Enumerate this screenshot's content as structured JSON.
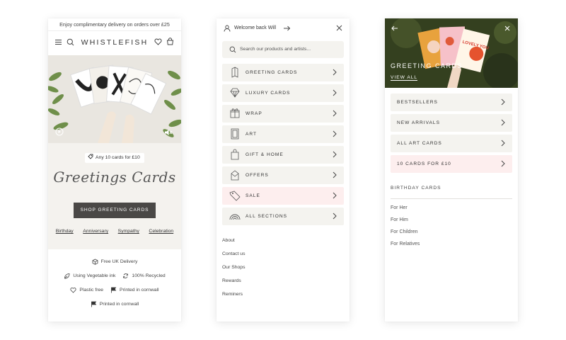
{
  "screen1": {
    "promo": "Enjoy complimentary delivery on orders over £25",
    "brand": "WHISTLEFISH",
    "offer_pill": "Any 10 cards for £10",
    "hero_title": "Greetings Cards",
    "shop_button": "SHOP GREETING CARDS",
    "links": [
      "Birthday",
      "Anniversary",
      "Sympathy",
      "Celebration"
    ],
    "features": {
      "delivery": "Free UK Delivery",
      "ink": "Using Vegetable ink",
      "recycled": "100% Recycled",
      "plastic": "Plastic free",
      "printed_a": "Printed in cornwall",
      "printed_b": "Printed in cornwall"
    }
  },
  "screen2": {
    "welcome": "Welcome back Will",
    "search_placeholder": "Search our products and artists...",
    "menu": [
      {
        "label": "GREETING CARDS",
        "icon": "card-icon"
      },
      {
        "label": "LUXURY CARDS",
        "icon": "diamond-icon"
      },
      {
        "label": "WRAP",
        "icon": "gift-icon"
      },
      {
        "label": "ART",
        "icon": "frame-icon"
      },
      {
        "label": "GIFT & HOME",
        "icon": "bag-icon"
      },
      {
        "label": "OFFERS",
        "icon": "envelope-icon"
      },
      {
        "label": "SALE",
        "icon": "tag-icon"
      },
      {
        "label": "ALL SECTIONS",
        "icon": "rainbow-icon"
      }
    ],
    "footer_links": [
      "About",
      "Contact us",
      "Our Shops",
      "Rewards",
      "Reminers"
    ]
  },
  "screen3": {
    "hero_title": "GREETING CARDS",
    "view_all": "VIEW ALL",
    "subcategories": [
      "BESTSELLERS",
      "NEW ARRIVALS",
      "ALL ART CARDS",
      "10 CARDS FOR £10"
    ],
    "section_header": "BIRTHDAY CARDS",
    "birthday_links": [
      "For Her",
      "For Him",
      "For Children",
      "For Relatives"
    ],
    "card_text": "LOVELY YOU"
  },
  "colors": {
    "menu_bg": "#f4f3ef",
    "sale_bg": "#fdeeee",
    "button_bg": "#4a4846",
    "beige_bg": "#f4f2ee"
  }
}
